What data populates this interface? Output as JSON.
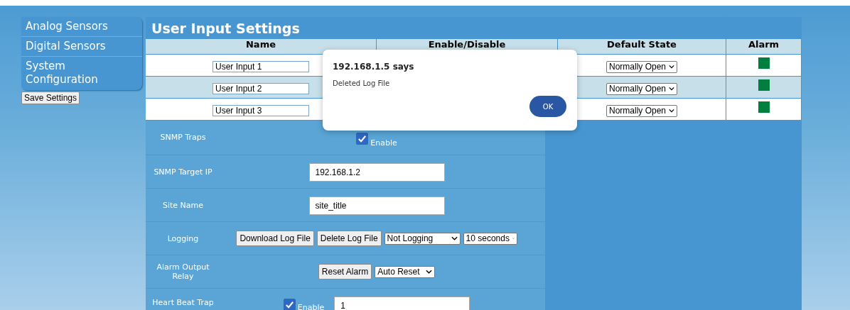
{
  "sidebar": {
    "items": [
      {
        "label": "Analog Sensors"
      },
      {
        "label": "Digital Sensors"
      },
      {
        "label": "System Configuration"
      }
    ],
    "save_button": "Save Settings"
  },
  "panel": {
    "title": "User Input Settings",
    "table": {
      "columns": [
        "Name",
        "Enable/Disable",
        "Default State",
        "Alarm"
      ],
      "rows": [
        {
          "name": "User Input 1",
          "default_state": "Normally Open",
          "color": "#007f3f"
        },
        {
          "name": "User Input 2",
          "default_state": "Normally Open",
          "color": "#007f3f"
        },
        {
          "name": "User Input 3",
          "default_state": "Normally Open",
          "color": "#007f3f"
        }
      ]
    },
    "settings": [
      {
        "label": "SNMP Traps",
        "kind": "checkbox",
        "checked": true,
        "checkbox_label": "Enable"
      },
      {
        "label": "SNMP Target IP",
        "kind": "text",
        "value": "192.168.1.2"
      },
      {
        "label": "Site Name",
        "kind": "text",
        "value": "site_title"
      },
      {
        "label": "Logging",
        "kind": "logging",
        "buttons": [
          "Download Log File",
          "Delete Log File"
        ],
        "dropdowns": [
          "Not Logging",
          "10 seconds"
        ]
      },
      {
        "label": "Alarm Output Relay",
        "kind": "alarm",
        "buttons": [
          "Reset Alarm"
        ],
        "dropdowns": [
          "Auto Reset"
        ]
      },
      {
        "label": "Heart Beat Trap",
        "kind": "checkbox_text",
        "checked": true,
        "checkbox_label": "Enable",
        "value": "1"
      }
    ]
  },
  "dialog": {
    "title": "192.168.1.5 says",
    "message": "Deleted Log File",
    "button": "OK"
  }
}
